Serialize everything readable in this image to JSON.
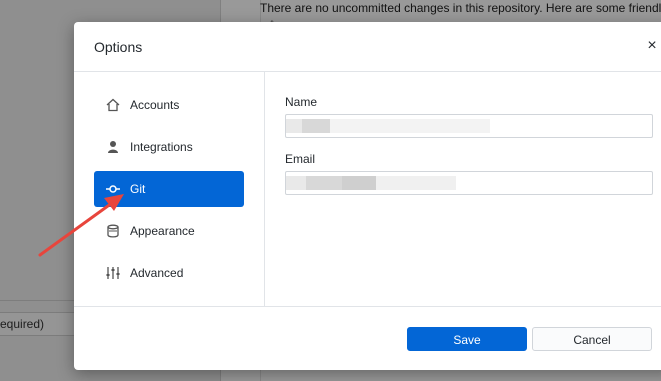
{
  "background": {
    "repo_message": "There are no uncommitted changes in this repository. Here are some friendl",
    "repo_message_line2": "                         ~     t",
    "bottom_field": "equired)"
  },
  "dialog": {
    "title": "Options",
    "close_glyph": "×",
    "nav": [
      {
        "label": "Accounts",
        "icon": "home-icon",
        "selected": false
      },
      {
        "label": "Integrations",
        "icon": "person-icon",
        "selected": false
      },
      {
        "label": "Git",
        "icon": "git-commit-icon",
        "selected": true
      },
      {
        "label": "Appearance",
        "icon": "paintcan-icon",
        "selected": false
      },
      {
        "label": "Advanced",
        "icon": "settings-sliders-icon",
        "selected": false
      }
    ],
    "fields": {
      "name_label": "Name",
      "name_value": "",
      "email_label": "Email",
      "email_value": ""
    },
    "footer": {
      "save_label": "Save",
      "cancel_label": "Cancel"
    }
  },
  "colors": {
    "accent": "#0366d6",
    "annotation_arrow": "#e8453c"
  }
}
